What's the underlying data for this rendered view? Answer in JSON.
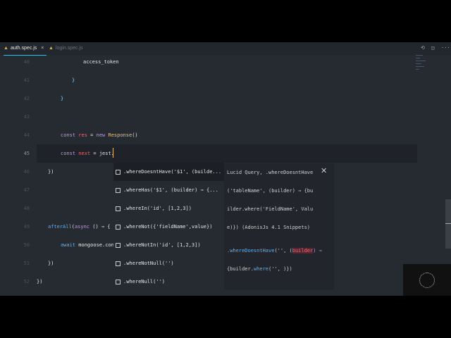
{
  "tabs": [
    {
      "label": "auth.spec.js",
      "active": true,
      "close": "×"
    },
    {
      "label": "login.spec.js",
      "active": false
    }
  ],
  "toolbar_icons": [
    "compare-changes-icon",
    "split-editor-icon",
    "more-actions-icon"
  ],
  "toolbar_more": "···",
  "lines": [
    {
      "num": "40",
      "text": "access_token"
    },
    {
      "num": "41",
      "text": "}"
    },
    {
      "num": "42",
      "text": "}"
    },
    {
      "num": "43",
      "text": ""
    },
    {
      "num": "44",
      "kw": "const",
      "var": "res",
      "eq": " = ",
      "kw2": "new",
      "cls": "Response",
      "rest": "()"
    },
    {
      "num": "45",
      "kw": "const",
      "var": "next",
      "eq": " = ",
      "rest": "jest."
    },
    {
      "num": "46",
      "text": "})"
    },
    {
      "num": "47",
      "text": ""
    },
    {
      "num": "48",
      "text": ""
    },
    {
      "num": "49",
      "fn": "afterAll",
      "rest1": "(",
      "kw": "async",
      "rest2": " () ⇒ {"
    },
    {
      "num": "50",
      "kw": "await",
      "rest": " mongoose.con"
    },
    {
      "num": "51",
      "text": "})"
    },
    {
      "num": "52",
      "text": "})"
    }
  ],
  "suggestions": [
    ".whereDoesntHave('$1', (builde...",
    ".whereHas('$1', (builder) ⇒ {...",
    ".whereIn('id', [1,2,3])",
    ".whereNot({'fieldName',value})",
    ".whereNotIn('id', [1,2,3])",
    ".whereNotNull('')",
    ".whereNull('')"
  ],
  "details": {
    "desc": [
      "Lucid Query, .whereDoesntHave",
      "('tableName', (builder) ⇒ {bu",
      "ilder.where('FieldName', Valu",
      "e)}) (AdonisJs 4.1 Snippets)"
    ],
    "code1": {
      "m": ".whereDoesntHave",
      "a": "('', (",
      "b": "builder",
      "c": ") ⇒"
    },
    "code2": {
      "a": "{builder.",
      "m": "where",
      "c": "('', )})"
    },
    "close": "✕"
  }
}
